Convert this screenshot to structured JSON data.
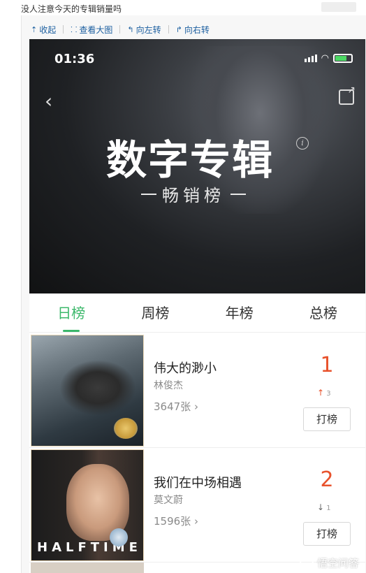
{
  "post": {
    "title": "没人注意今天的专辑销量吗"
  },
  "toolbar": {
    "collapse_label": "收起",
    "view_large_label": "查看大图",
    "rotate_left_label": "向左转",
    "rotate_right_label": "向右转"
  },
  "status_bar": {
    "time": "01:36"
  },
  "banner": {
    "title": "数字专辑",
    "subtitle": "畅销榜",
    "info_glyph": "i"
  },
  "tabs": [
    {
      "label": "日榜",
      "active": true
    },
    {
      "label": "周榜",
      "active": false
    },
    {
      "label": "年榜",
      "active": false
    },
    {
      "label": "总榜",
      "active": false
    }
  ],
  "albums": [
    {
      "title": "伟大的渺小",
      "artist": "林俊杰",
      "sales": "3647张",
      "rank": "1",
      "change": "3",
      "change_direction": "up",
      "button": "打榜"
    },
    {
      "title": "我们在中场相遇",
      "artist": "莫文蔚",
      "sales": "1596张",
      "rank": "2",
      "change": "1",
      "change_direction": "down",
      "button": "打榜",
      "cover_text": "HALFTIME"
    }
  ],
  "watermark": {
    "text": "悟空问答"
  },
  "colors": {
    "accent_green": "#3cb86b",
    "rank_red": "#e8522c",
    "link_blue": "#1c5fa0"
  }
}
